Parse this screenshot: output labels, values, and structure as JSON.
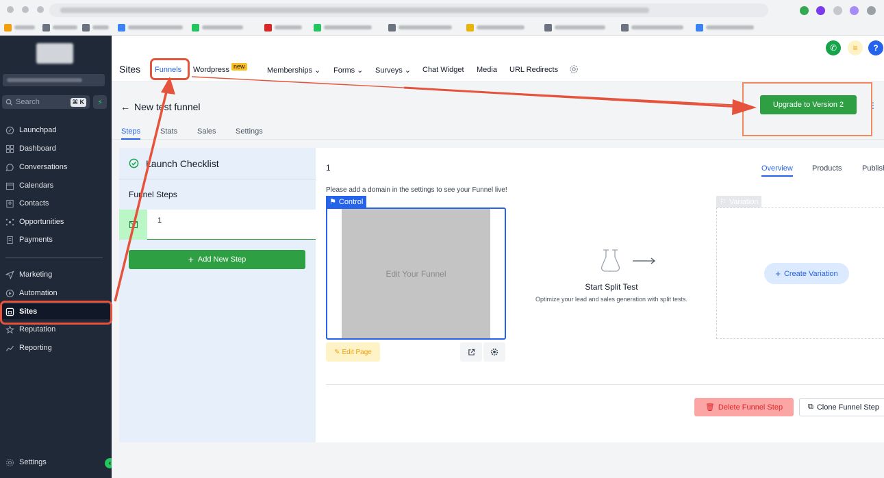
{
  "sidebar": {
    "search_placeholder": "Search",
    "search_shortcut": "⌘ K",
    "items": [
      {
        "label": "Launchpad",
        "icon": "rocket-icon"
      },
      {
        "label": "Dashboard",
        "icon": "grid-icon"
      },
      {
        "label": "Conversations",
        "icon": "chat-icon"
      },
      {
        "label": "Calendars",
        "icon": "calendar-icon"
      },
      {
        "label": "Contacts",
        "icon": "contacts-icon"
      },
      {
        "label": "Opportunities",
        "icon": "network-icon"
      },
      {
        "label": "Payments",
        "icon": "receipt-icon"
      },
      {
        "label": "Marketing",
        "icon": "send-icon"
      },
      {
        "label": "Automation",
        "icon": "automation-icon"
      },
      {
        "label": "Sites",
        "icon": "globe-icon",
        "active": true
      },
      {
        "label": "Reputation",
        "icon": "star-icon"
      },
      {
        "label": "Reporting",
        "icon": "trend-icon"
      }
    ],
    "settings_label": "Settings"
  },
  "topnav": {
    "title": "Sites",
    "items": [
      "Funnels",
      "Wordpress",
      "Memberships",
      "Forms",
      "Surveys",
      "Chat Widget",
      "Media",
      "URL Redirects"
    ],
    "new_badge": "new"
  },
  "funnel": {
    "title": "New test funnel",
    "upgrade_label": "Upgrade to Version 2",
    "tabs": [
      "Steps",
      "Stats",
      "Sales",
      "Settings"
    ]
  },
  "left_panel": {
    "checklist_label": "Launch Checklist",
    "steps_label": "Funnel Steps",
    "step_name": "1",
    "add_step_label": "Add New Step"
  },
  "right_panel": {
    "step_title": "1",
    "tabs": [
      "Overview",
      "Products",
      "Publish"
    ],
    "note": "Please add a domain in the settings to see your Funnel live!",
    "control_label": "Control",
    "preview_label": "Edit Your Funnel",
    "edit_page_label": "Edit Page",
    "split_title": "Start Split Test",
    "split_sub": "Optimize your lead and sales generation with split tests.",
    "variation_label": "Variation",
    "create_variation_label": "Create Variation",
    "delete_label": "Delete Funnel Step",
    "clone_label": "Clone Funnel Step"
  },
  "colors": {
    "accent": "#2563eb",
    "green": "#2ea043",
    "annotation": "#e5533d"
  }
}
